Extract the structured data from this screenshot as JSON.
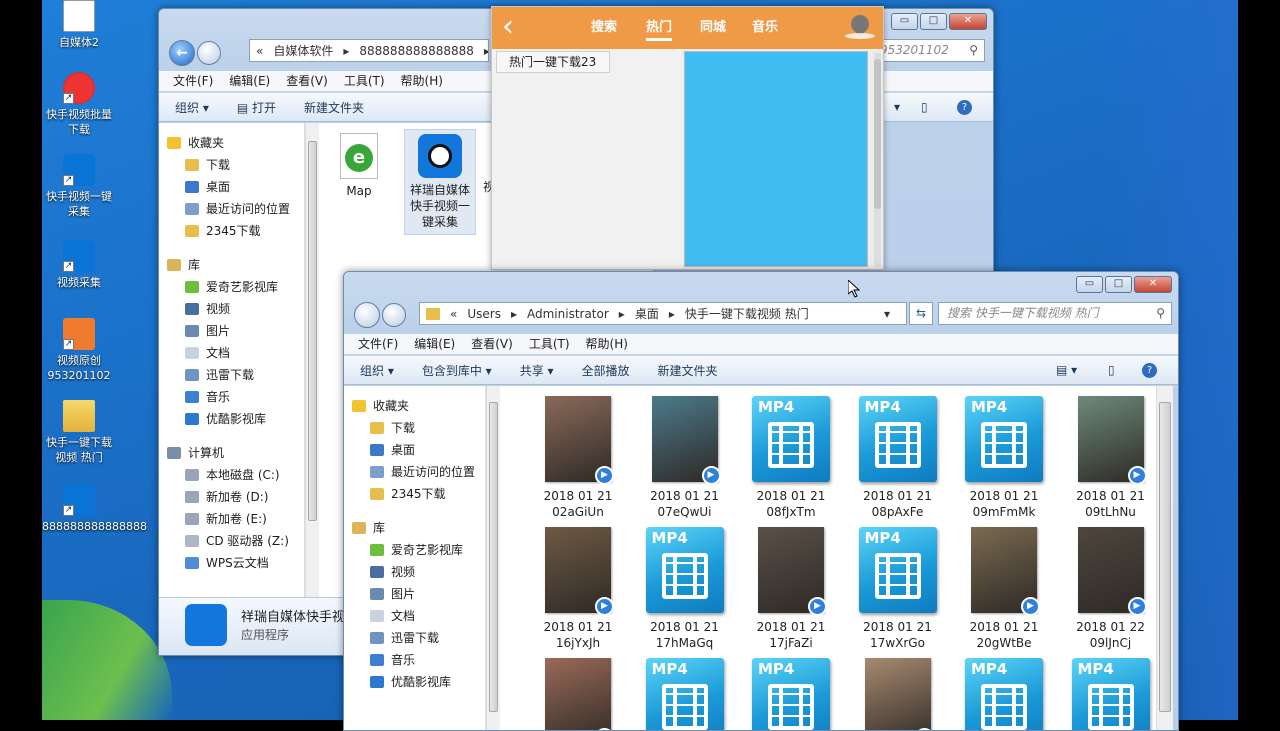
{
  "desktop": {
    "icons": [
      {
        "label": "自媒体2",
        "kind": "doc"
      },
      {
        "label": "快手视频批量下载",
        "kind": "red"
      },
      {
        "label": "快手视频一键采集",
        "kind": "app"
      },
      {
        "label": "视频采集",
        "kind": "app"
      },
      {
        "label": "视频原创953201102",
        "kind": "orange"
      },
      {
        "label": "快手一键下载视频 热门",
        "kind": "folder"
      },
      {
        "label": "888888888888888",
        "kind": "app"
      }
    ]
  },
  "back_window": {
    "address": [
      "«",
      "自媒体软件",
      "▸",
      "888888888888888",
      "▸",
      "快"
    ],
    "search_partial": "953201102",
    "menu": [
      "文件(F)",
      "编辑(E)",
      "查看(V)",
      "工具(T)",
      "帮助(H)"
    ],
    "toolbar": {
      "organize": "组织 ▾",
      "open": "打开",
      "new_folder": "新建文件夹"
    },
    "nav": {
      "favorites_header": "收藏夹",
      "favorites": [
        "下载",
        "桌面",
        "最近访问的位置",
        "2345下载"
      ],
      "library_header": "库",
      "libraries": [
        "爱奇艺影视库",
        "视频",
        "图片",
        "文档",
        "迅雷下载",
        "音乐",
        "优酷影视库"
      ],
      "computer_header": "计算机",
      "drives": [
        "本地磁盘 (C:)",
        "新加卷 (D:)",
        "新加卷 (E:)",
        "CD 驱动器 (Z:)",
        "WPS云文档"
      ]
    },
    "files": [
      {
        "name": "Map"
      },
      {
        "name": "祥瑞自媒体快手视频一键采集"
      },
      {
        "name": "视"
      }
    ],
    "details": {
      "name": "祥瑞自媒体快手视",
      "type": "应用程序"
    }
  },
  "popup": {
    "tabs": [
      "搜索",
      "热门",
      "同城",
      "音乐"
    ],
    "active_tab": "热门",
    "left_tab": "热门一键下载23",
    "back_glyph": "‹"
  },
  "front_window": {
    "address": [
      "«",
      "Users",
      "▸",
      "Administrator",
      "▸",
      "桌面",
      "▸",
      "快手一键下载视频 热门"
    ],
    "search_placeholder": "搜索 快手一键下载视频 热门",
    "menu": [
      "文件(F)",
      "编辑(E)",
      "查看(V)",
      "工具(T)",
      "帮助(H)"
    ],
    "toolbar": [
      "组织 ▾",
      "包含到库中 ▾",
      "共享 ▾",
      "全部播放",
      "新建文件夹"
    ],
    "nav": {
      "favorites_header": "收藏夹",
      "favorites": [
        "下载",
        "桌面",
        "最近访问的位置",
        "2345下载"
      ],
      "library_header": "库",
      "libraries": [
        "爱奇艺影视库",
        "视频",
        "图片",
        "文档",
        "迅雷下载",
        "音乐",
        "优酷影视库"
      ]
    },
    "files": [
      {
        "l1": "2018 01 21",
        "l2": "02aGiUn",
        "kind": "photo",
        "color": "#8a6a5a"
      },
      {
        "l1": "2018 01 21",
        "l2": "07eQwUi",
        "kind": "photo",
        "color": "#4c7a8c"
      },
      {
        "l1": "2018 01 21",
        "l2": "08fJxTm",
        "kind": "mp4"
      },
      {
        "l1": "2018 01 21",
        "l2": "08pAxFe",
        "kind": "mp4"
      },
      {
        "l1": "2018 01 21",
        "l2": "09mFmMk",
        "kind": "mp4"
      },
      {
        "l1": "2018 01 21",
        "l2": "09tLhNu",
        "kind": "photo",
        "color": "#6d8a7a"
      },
      {
        "l1": "2018 01 21",
        "l2": "16jYxJh",
        "kind": "photo",
        "color": "#6e5a44"
      },
      {
        "l1": "2018 01 21",
        "l2": "17hMaGq",
        "kind": "mp4"
      },
      {
        "l1": "2018 01 21",
        "l2": "17jFaZi",
        "kind": "photo",
        "color": "#5a5048"
      },
      {
        "l1": "2018 01 21",
        "l2": "17wXrGo",
        "kind": "mp4"
      },
      {
        "l1": "2018 01 21",
        "l2": "20gWtBe",
        "kind": "photo",
        "color": "#7a6a50"
      },
      {
        "l1": "2018 01 22",
        "l2": "09lJnCj",
        "kind": "photo",
        "color": "#4e463e"
      },
      {
        "l1": "",
        "l2": "",
        "kind": "photo",
        "color": "#9a6a58"
      },
      {
        "l1": "",
        "l2": "",
        "kind": "mp4"
      },
      {
        "l1": "",
        "l2": "",
        "kind": "mp4"
      },
      {
        "l1": "",
        "l2": "",
        "kind": "photo",
        "color": "#a88a70"
      },
      {
        "l1": "",
        "l2": "",
        "kind": "mp4"
      },
      {
        "l1": "",
        "l2": "",
        "kind": "mp4"
      }
    ],
    "mp4_label": "MP4"
  },
  "buttons": {
    "minimize": "▭",
    "maximize": "□",
    "close": "✕"
  }
}
